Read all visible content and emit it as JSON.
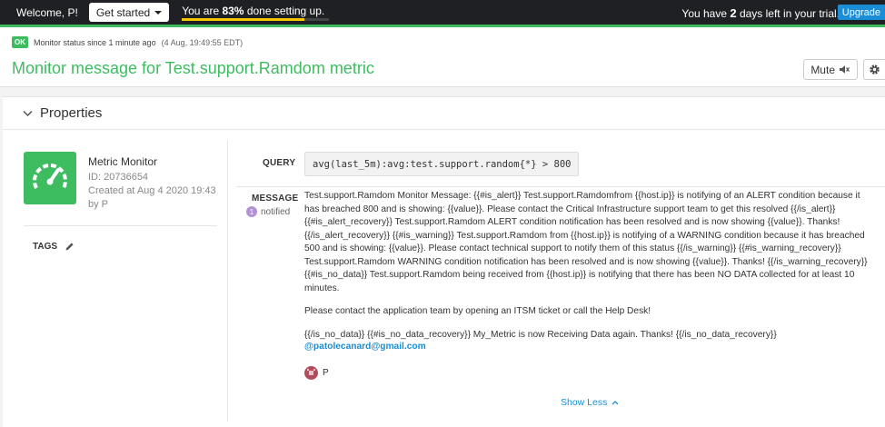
{
  "topbar": {
    "welcome": "Welcome, P!",
    "get_started": "Get started",
    "progress_text_before": "You are ",
    "progress_percent_text": "83%",
    "progress_text_after": " done setting up.",
    "progress_fraction": 0.83,
    "trial_before": "You have ",
    "trial_days": "2",
    "trial_after": " days left in your trial.",
    "upgrade": "Upgrade"
  },
  "header": {
    "status_badge": "OK",
    "status_text": "Monitor status since 1 minute ago",
    "status_timestamp": "(4 Aug, 19:49:55 EDT)",
    "title": "Monitor message for Test.support.Ramdom metric",
    "mute_label": "Mute"
  },
  "properties": {
    "heading": "Properties",
    "monitor_type": "Metric Monitor",
    "id_text": "ID: 20736654",
    "created_text": "Created at Aug 4 2020 19:43",
    "by_text": "by P",
    "tags_label": "TAGS",
    "query_label": "QUERY",
    "query": "avg(last_5m):avg:test.support.random{*} > 800",
    "message_label": "MESSAGE",
    "notified_count": "1",
    "notified_label": "notified",
    "message_paragraph_1": "Test.support.Ramdom Monitor Message: {{#is_alert}} Test.support.Ramdomfrom {{host.ip}} is notifying of an ALERT condition because it has breached 800 and is showing: {{value}}. Please contact the Critical Infrastructure support team to get this resolved {{/is_alert}} {{#is_alert_recovery}} Test.support.Ramdom ALERT condition notification has been resolved and is now showing {{value}}. Thanks! {{/is_alert_recovery}} {{#is_warning}} Test.support.Ramdom from {{host.ip}} is notifying of a WARNING condition because it has breached 500 and is showing: {{value}}. Please contact technical support to notify them of this status {{/is_warning}} {{#is_warning_recovery}} Test.support.Ramdom WARNING condition notification has been resolved and is now showing {{value}}. Thanks! {{/is_warning_recovery}} {{#is_no_data}} Test.support.Ramdom being received from {{host.ip}} is notifying that there has been NO DATA collected for at least 10 minutes.",
    "message_paragraph_2": "Please contact the application team by opening an ITSM ticket or call the Help Desk!",
    "message_paragraph_3": "{{/is_no_data}} {{#is_no_data_recovery}} My_Metric is now Receiving Data again. Thanks! {{/is_no_data_recovery}}",
    "email": "@patolecanard@gmail.com",
    "user_name": "P",
    "show_less": "Show Less"
  },
  "colors": {
    "ok_green": "#3ebc60",
    "link_blue": "#1a8dd6",
    "progress_yellow": "#f2c600"
  },
  "icons": [
    "caret-down-icon",
    "speaker-mute-icon",
    "gear-icon",
    "chevron-down-icon",
    "gauge-icon",
    "pencil-icon",
    "avatar-icon",
    "chevron-up-icon"
  ]
}
